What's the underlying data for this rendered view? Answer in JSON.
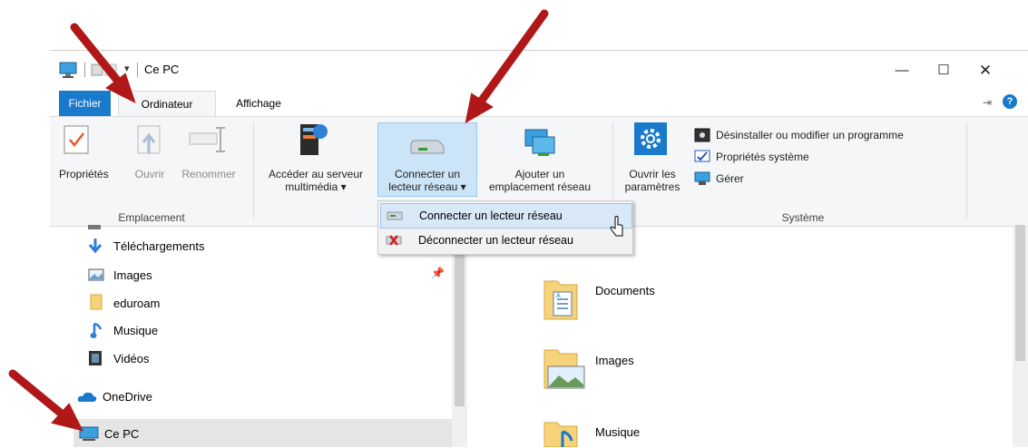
{
  "title_bar": {
    "title": "Ce PC"
  },
  "tabs": {
    "file": "Fichier",
    "computer": "Ordinateur",
    "view": "Affichage"
  },
  "ribbon": {
    "properties": "Propriétés",
    "open": "Ouvrir",
    "rename": "Renommer",
    "location_group": "Emplacement",
    "media_server_line1": "Accéder au serveur",
    "media_server_line2": "multimédia",
    "map_drive_line1": "Connecter un",
    "map_drive_line2": "lecteur réseau",
    "add_location_line1": "Ajouter un",
    "add_location_line2": "emplacement réseau",
    "open_settings_line1": "Ouvrir les",
    "open_settings_line2": "paramètres",
    "uninstall": "Désinstaller ou modifier un programme",
    "system_properties": "Propriétés système",
    "manage": "Gérer",
    "system_group": "Système"
  },
  "dropdown": {
    "connect": "Connecter un lecteur réseau",
    "disconnect": "Déconnecter un lecteur réseau"
  },
  "nav": {
    "items": [
      "Téléchargements",
      "Images",
      "eduroam",
      "Musique",
      "Vidéos",
      "OneDrive",
      "Ce PC"
    ]
  },
  "content": {
    "folders": [
      "Documents",
      "Images",
      "Musique"
    ]
  },
  "colors": {
    "accent": "#1979ca",
    "arrow": "#b01818",
    "selection": "#cce8ff"
  }
}
